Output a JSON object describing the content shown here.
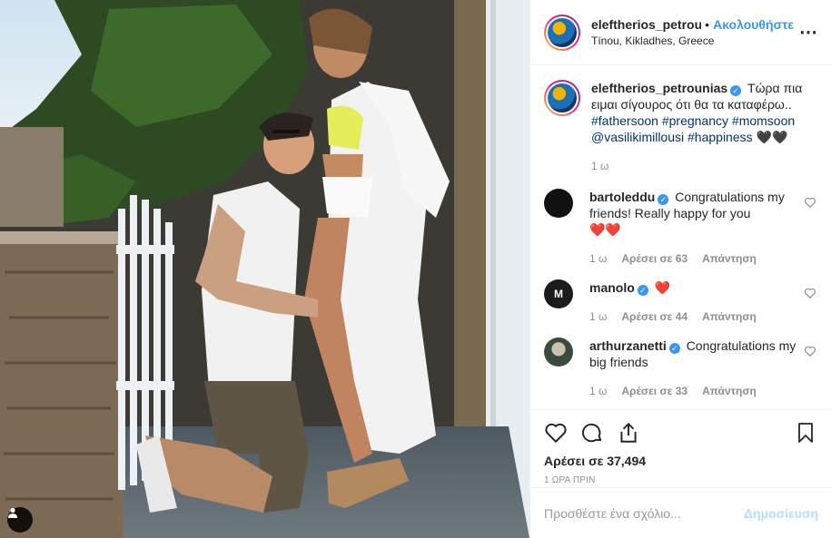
{
  "header": {
    "username": "eleftherios_petrounias",
    "separator": "•",
    "follow_label": "Ακολουθήστε",
    "location": "Tínou, Kikladhes, Greece",
    "more_icon": "ellipsis-icon"
  },
  "caption": {
    "username": "eleftherios_petrounias",
    "text": "Τώρα πια ειμαι σίγουρος ότι θα τα καταφέρω..",
    "tags": [
      "#fathersoon",
      "#pregnancy",
      "#momsoon",
      "@vasilikimillousi",
      "#happiness"
    ],
    "emoji": "🖤🖤",
    "age": "1 ω"
  },
  "comments": [
    {
      "username": "bartoleddu",
      "verified": true,
      "text": "Congratulations my friends! Really happy for you",
      "emoji": "❤️❤️",
      "age": "1 ω",
      "likes": "Αρέσει σε 63",
      "reply": "Απάντηση"
    },
    {
      "username": "manolo",
      "verified": true,
      "text": "",
      "emoji": "❤️",
      "age": "1 ω",
      "likes": "Αρέσει σε 44",
      "reply": "Απάντηση"
    },
    {
      "username": "arthurzanetti",
      "verified": true,
      "text": "Congratulations my big friends",
      "emoji": "",
      "age": "1 ω",
      "likes": "Αρέσει σε 33",
      "reply": "Απάντηση"
    }
  ],
  "footer": {
    "likes": "Αρέσει σε 37,494",
    "time": "1 ΩΡΑ ΠΡΙΝ",
    "comment_placeholder": "Προσθέστε ένα σχόλιο...",
    "post_label": "Δημοσίευση"
  },
  "colors": {
    "accent": "#3897f0",
    "heart": "#ed4956",
    "muted": "#8e8e8e"
  }
}
